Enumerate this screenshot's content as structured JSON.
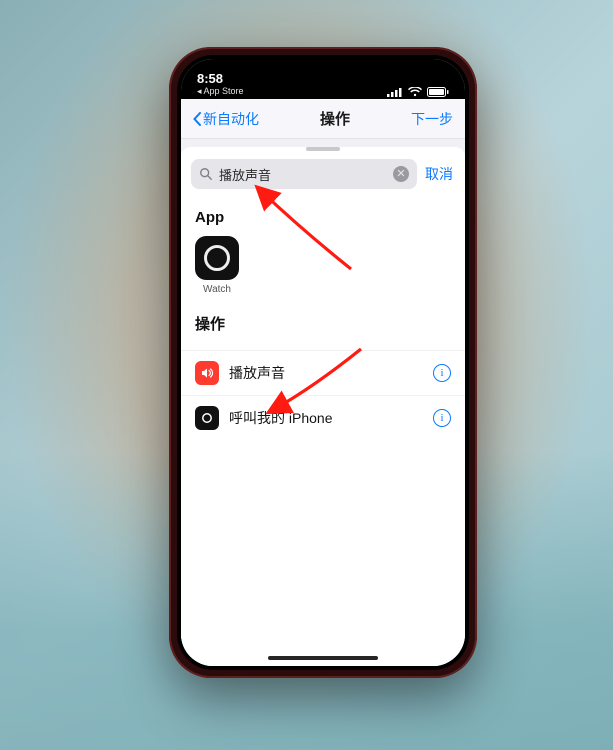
{
  "status": {
    "time": "8:58",
    "back_app": "App Store"
  },
  "nav": {
    "back_label": "新自动化",
    "title": "操作",
    "next_label": "下一步"
  },
  "search": {
    "value": "播放声音",
    "cancel_label": "取消"
  },
  "sections": {
    "app_title": "App",
    "actions_title": "操作"
  },
  "apps": [
    {
      "label": "Watch",
      "icon": "watch"
    }
  ],
  "actions": [
    {
      "label": "播放声音",
      "icon": "sound",
      "color": "red"
    },
    {
      "label": "呼叫我的 iPhone",
      "icon": "watch",
      "color": "black"
    }
  ],
  "colors": {
    "accent": "#0a7aff",
    "annotation": "#ff1a12"
  }
}
